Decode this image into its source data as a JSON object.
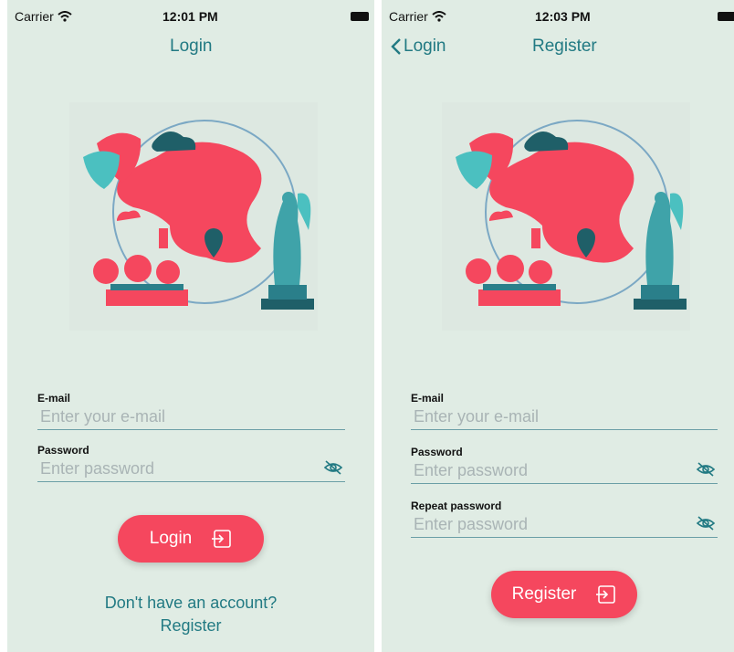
{
  "login_screen": {
    "status": {
      "carrier": "Carrier",
      "time": "12:01 PM"
    },
    "nav_title": "Login",
    "email": {
      "label": "E-mail",
      "placeholder": "Enter your e-mail",
      "value": ""
    },
    "password": {
      "label": "Password",
      "placeholder": "Enter password",
      "value": ""
    },
    "button_label": "Login",
    "prompt_text": "Don't have an account?",
    "register_link": "Register"
  },
  "register_screen": {
    "status": {
      "carrier": "Carrier",
      "time": "12:03 PM"
    },
    "back_label": "Login",
    "nav_title": "Register",
    "email": {
      "label": "E-mail",
      "placeholder": "Enter your e-mail",
      "value": ""
    },
    "password": {
      "label": "Password",
      "placeholder": "Enter password",
      "value": ""
    },
    "repeat_password": {
      "label": "Repeat password",
      "placeholder": "Enter password",
      "value": ""
    },
    "button_label": "Register"
  },
  "icons": {
    "wifi": "wifi-icon",
    "battery": "battery-icon",
    "back": "chevron-left-icon",
    "eye": "eye-slash-icon",
    "login": "sign-in-icon"
  },
  "colors": {
    "background": "#e0ece4",
    "accent": "#f5475e",
    "teal": "#227a83",
    "underline": "#6b9fa6"
  }
}
